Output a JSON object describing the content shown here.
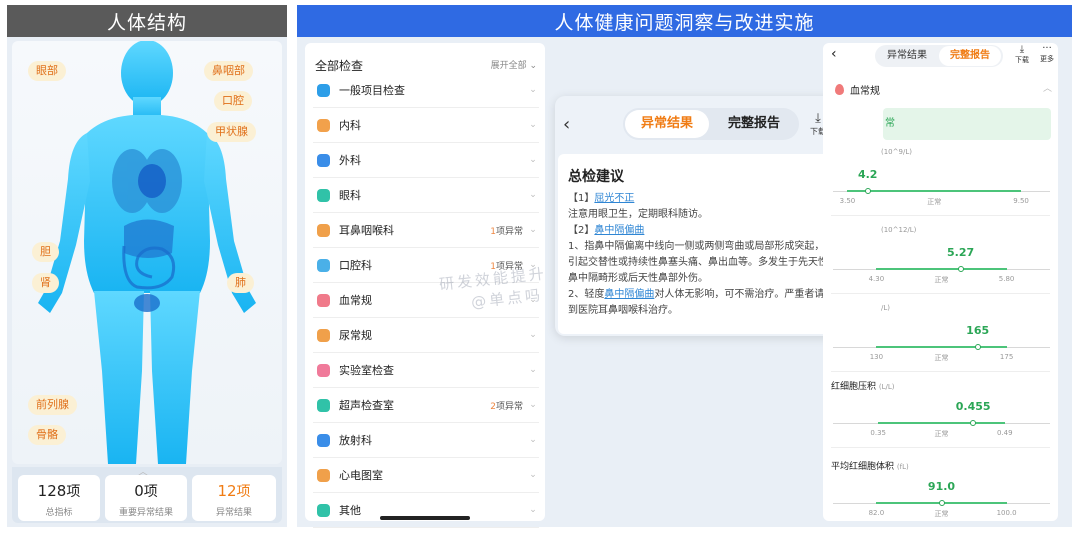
{
  "left_panel": {
    "title": "人体结构",
    "organ_tags": [
      "眼部",
      "鼻咽部",
      "口腔",
      "甲状腺",
      "胆",
      "肾",
      "肺",
      "前列腺",
      "骨骼"
    ],
    "stats": [
      {
        "value": "128",
        "unit": "项",
        "label": "总指标",
        "color": "#222222"
      },
      {
        "value": "0",
        "unit": "项",
        "label": "重要异常结果",
        "color": "#222222"
      },
      {
        "value": "12",
        "unit": "项",
        "label": "异常结果",
        "color": "#f07c14"
      }
    ]
  },
  "right_panel": {
    "title": "人体健康问题洞察与改进实施"
  },
  "check_list": {
    "title": "全部检查",
    "expand_label": "展开全部",
    "items": [
      {
        "label": "一般项目检查",
        "note_num": "",
        "note_text": "",
        "icon_color": "#2d9ee8"
      },
      {
        "label": "内科",
        "note_num": "",
        "note_text": "",
        "icon_color": "#f2a14b"
      },
      {
        "label": "外科",
        "note_num": "",
        "note_text": "",
        "icon_color": "#3a8de8"
      },
      {
        "label": "眼科",
        "note_num": "",
        "note_text": "",
        "icon_color": "#30c2a8"
      },
      {
        "label": "耳鼻咽喉科",
        "note_num": "1",
        "note_text": "项异常",
        "icon_color": "#f0a04a"
      },
      {
        "label": "口腔科",
        "note_num": "1",
        "note_text": "项异常",
        "icon_color": "#4ab0e8"
      },
      {
        "label": "血常规",
        "note_num": "",
        "note_text": "",
        "icon_color": "#f07a8a"
      },
      {
        "label": "尿常规",
        "note_num": "",
        "note_text": "",
        "icon_color": "#f0a04a"
      },
      {
        "label": "实验室检查",
        "note_num": "",
        "note_text": "",
        "icon_color": "#f07a9a"
      },
      {
        "label": "超声检查室",
        "note_num": "2",
        "note_text": "项异常",
        "icon_color": "#30c2a8"
      },
      {
        "label": "放射科",
        "note_num": "",
        "note_text": "",
        "icon_color": "#3a8de8"
      },
      {
        "label": "心电图室",
        "note_num": "",
        "note_text": "",
        "icon_color": "#f0a04a"
      },
      {
        "label": "其他",
        "note_num": "",
        "note_text": "",
        "icon_color": "#30c2a8"
      }
    ]
  },
  "advice": {
    "back_icon": "back-chevron-icon",
    "tab_abnormal": "异常结果",
    "tab_full": "完整报告",
    "download_label": "下载",
    "more_label": "更多",
    "title": "总检建议",
    "lines": [
      {
        "pre": "【1】",
        "link": "屈光不正",
        "post": ""
      },
      {
        "pre": "注意用眼卫生，定期眼科随访。",
        "link": "",
        "post": ""
      },
      {
        "pre": "【2】",
        "link": "鼻中隔偏曲",
        "post": ""
      },
      {
        "pre": "1、指鼻中隔偏离中线向一侧或两侧弯曲或局部形成突起，",
        "link": "",
        "post": ""
      },
      {
        "pre": "引起交替性或持续性鼻塞头痛、鼻出血等。多发生于先天性",
        "link": "",
        "post": ""
      },
      {
        "pre": "鼻中隔畸形或后天性鼻部外伤。",
        "link": "",
        "post": ""
      },
      {
        "pre": "2、轻度",
        "link": "鼻中隔偏曲",
        "post": "对人体无影响，可不需治疗。严重者请"
      },
      {
        "pre": "到医院耳鼻咽喉科治疗。",
        "link": "",
        "post": ""
      }
    ]
  },
  "results": {
    "tab_abnormal": "异常结果",
    "tab_full": "完整报告",
    "download_label": "下载",
    "more_label": "更多",
    "section": "血常规",
    "normal_text": "常",
    "normal_label": "正常",
    "indicators": [
      {
        "name": "",
        "unit": "(10^9/L)",
        "value": "4.2",
        "low": "3.50",
        "high": "9.50",
        "min": 3.0,
        "max": 10.5
      },
      {
        "name": "",
        "unit": "(10^12/L)",
        "value": "5.27",
        "low": "4.30",
        "high": "5.80",
        "min": 3.8,
        "max": 6.3
      },
      {
        "name": "",
        "unit": "/L)",
        "value": "165",
        "low": "130",
        "high": "175",
        "min": 115,
        "max": 190
      },
      {
        "name": "红细胞压积",
        "unit": "(L/L)",
        "value": "0.455",
        "low": "0.35",
        "high": "0.49",
        "min": 0.3,
        "max": 0.54
      },
      {
        "name": "平均红细胞体积",
        "unit": "(fL)",
        "value": "91.0",
        "low": "82.0",
        "high": "100.0",
        "min": 76,
        "max": 106
      }
    ]
  },
  "watermark": {
    "line1": "研发效能提升",
    "line2": "@单点吗"
  }
}
